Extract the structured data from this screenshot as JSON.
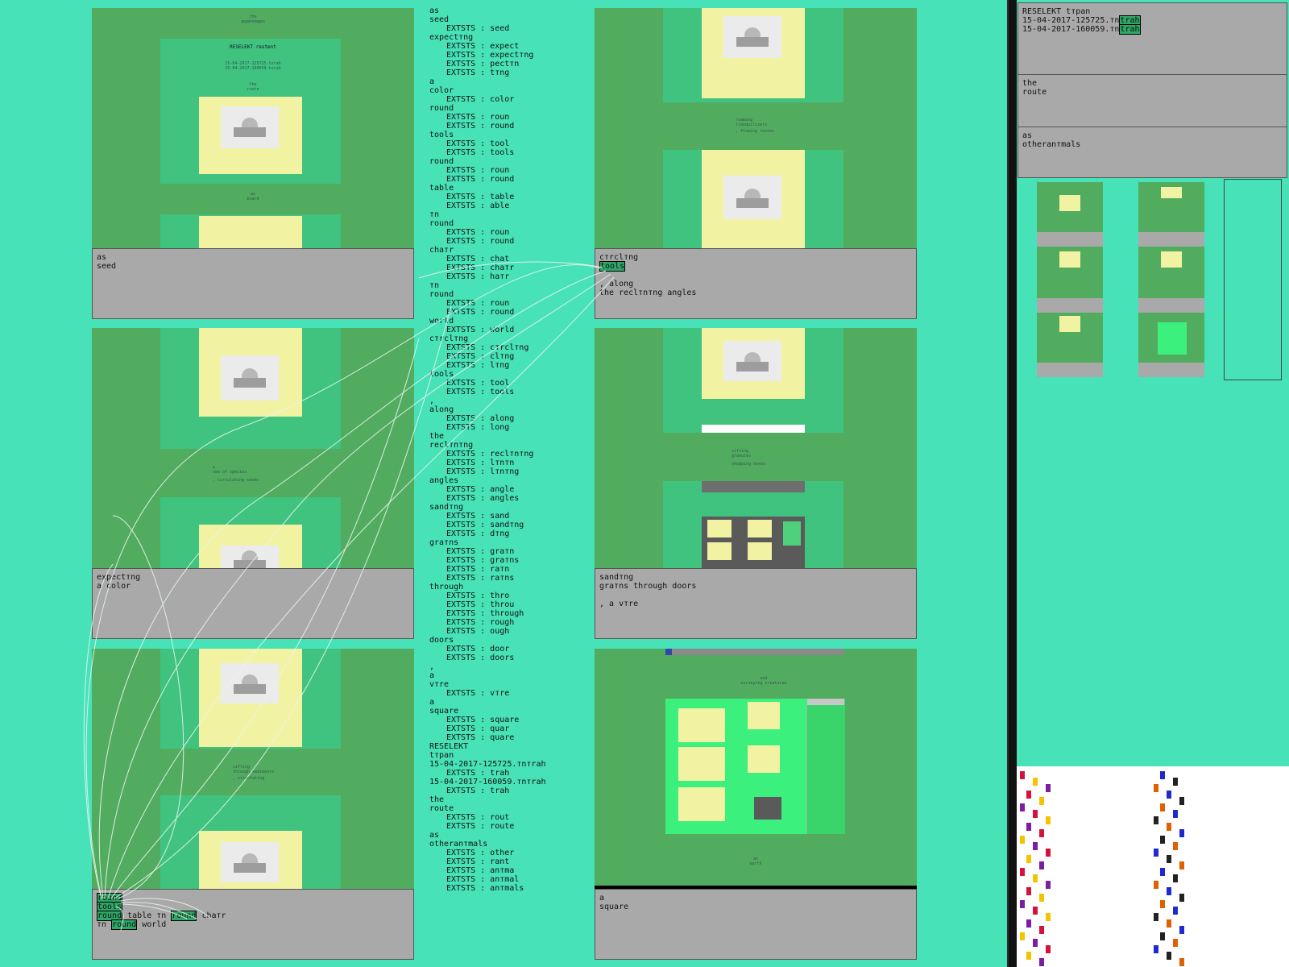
{
  "panels": [
    {
      "id": "seed",
      "caption_lines": [
        "as",
        "seed"
      ],
      "thumb_texts": [
        "the\nappendages",
        "RESELEKT restent",
        "15-04-2017-125725.tnrah\n15-04-2017-160059.tnrah",
        "the\nroute",
        "as\nboard"
      ]
    },
    {
      "id": "expecting",
      "caption_lines": [
        "expectтng",
        "a color"
      ],
      "thumb_texts": [
        "a\nsea of species",
        ", circulating seeds"
      ]
    },
    {
      "id": "round",
      "caption_segments": [
        [
          {
            "t": "round",
            "h": true
          }
        ],
        [
          {
            "t": "tools",
            "h": true
          }
        ],
        [
          {
            "t": "round",
            "h": true
          },
          {
            "t": " table тn ",
            "h": false
          },
          {
            "t": "round",
            "h": true
          },
          {
            "t": " chaтr",
            "h": false
          }
        ],
        [
          {
            "t": "тn ",
            "h": false
          },
          {
            "t": "round",
            "h": true
          },
          {
            "t": " world",
            "h": false
          }
        ]
      ],
      "thumb_texts": [
        "sifting\nthrough sediments",
        ", circulating"
      ]
    },
    {
      "id": "circling",
      "caption_segments": [
        [
          {
            "t": "cтrclтng",
            "h": false
          }
        ],
        [
          {
            "t": "tools",
            "h": true
          }
        ],
        [
          {
            "t": "",
            "h": false
          }
        ],
        [
          {
            "t": ", along",
            "h": false
          }
        ],
        [
          {
            "t": "the reclтnтng angles",
            "h": false
          }
        ]
      ],
      "thumb_texts": [
        "roaming\ntranquilizers",
        ", flowing routes"
      ]
    },
    {
      "id": "sanding",
      "caption_lines": [
        "sandтng",
        "graтns through doors",
        "",
        ", a vтre"
      ],
      "thumb_texts": [
        "sifting\ngranules",
        "shopping boxes"
      ]
    },
    {
      "id": "square",
      "caption_lines": [
        "a",
        "square"
      ],
      "thumb_texts": [
        "and\nsurveying creatures",
        "as\nearth"
      ]
    }
  ],
  "wordlist": [
    {
      "w": "as"
    },
    {
      "w": "seed",
      "ex": [
        "seed"
      ]
    },
    {
      "w": "expectтng",
      "ex": [
        "expect",
        "expectтng",
        "pectтn",
        "tтng"
      ]
    },
    {
      "w": "a"
    },
    {
      "w": "color",
      "ex": [
        "color"
      ]
    },
    {
      "w": "round",
      "ex": [
        "roun",
        "round"
      ]
    },
    {
      "w": "tools",
      "ex": [
        "tool",
        "tools"
      ]
    },
    {
      "w": "round",
      "ex": [
        "roun",
        "round"
      ]
    },
    {
      "w": "table",
      "ex": [
        "table",
        "able"
      ]
    },
    {
      "w": "тn"
    },
    {
      "w": "round",
      "ex": [
        "roun",
        "round"
      ]
    },
    {
      "w": "chaтr",
      "ex": [
        "chat",
        "chaтr",
        "haтr"
      ]
    },
    {
      "w": "тn"
    },
    {
      "w": "round",
      "ex": [
        "roun",
        "round"
      ]
    },
    {
      "w": "world",
      "ex": [
        "world"
      ]
    },
    {
      "w": "cтrclтng",
      "ex": [
        "cтrclтng",
        "clтng",
        "lтng"
      ]
    },
    {
      "w": "tools",
      "ex": [
        "tool",
        "tools"
      ]
    },
    {
      "w": ","
    },
    {
      "w": "along",
      "ex": [
        "along",
        "long"
      ]
    },
    {
      "w": "the"
    },
    {
      "w": "reclтnтng",
      "ex": [
        "reclтnтng",
        "lтnтn",
        "lтnтng"
      ]
    },
    {
      "w": "angles",
      "ex": [
        "angle",
        "angles"
      ]
    },
    {
      "w": "sandтng",
      "ex": [
        "sand",
        "sandтng",
        "dтng"
      ]
    },
    {
      "w": "graтns",
      "ex": [
        "graтn",
        "graтns",
        "raтn",
        "raтns"
      ]
    },
    {
      "w": "through",
      "ex": [
        "thro",
        "throu",
        "through",
        "rough",
        "ough"
      ]
    },
    {
      "w": "doors",
      "ex": [
        "door",
        "doors"
      ]
    },
    {
      "w": ","
    },
    {
      "w": "a"
    },
    {
      "w": "vтre",
      "ex": [
        "vтre"
      ]
    },
    {
      "w": "a"
    },
    {
      "w": "square",
      "ex": [
        "square",
        "quar",
        "quare"
      ]
    },
    {
      "w": "RESELEKT"
    },
    {
      "w": "tтpan"
    },
    {
      "w": "15-04-2017-125725.тnтrah",
      "ex": [
        "trah"
      ]
    },
    {
      "w": "15-04-2017-160059.тnтrah",
      "ex": [
        "trah"
      ]
    },
    {
      "w": "the"
    },
    {
      "w": "route",
      "ex": [
        "rout",
        "route"
      ]
    },
    {
      "w": "as"
    },
    {
      "w": "otheranтmals",
      "ex": [
        "other",
        "rant",
        "anтma",
        "anтmal",
        "anтmals"
      ]
    }
  ],
  "exists_prefix": "EXTSTS : ",
  "sidebar": {
    "title": "RESELEKT tтpan",
    "files": [
      {
        "name": "15-04-2017-125725.тn",
        "tag": "trah"
      },
      {
        "name": "15-04-2017-160059.тn",
        "tag": "trah"
      }
    ],
    "sections": [
      [
        "the",
        "route"
      ],
      [
        "as",
        "otheranтmals"
      ]
    ]
  },
  "colors": {
    "background": "#47e2b8",
    "panel_green": "#52ac5f",
    "inner_green": "#3fc37f",
    "paper": "#f2f3a2",
    "caption_gray": "#a9a9a9",
    "highlight": "#2fa766"
  }
}
